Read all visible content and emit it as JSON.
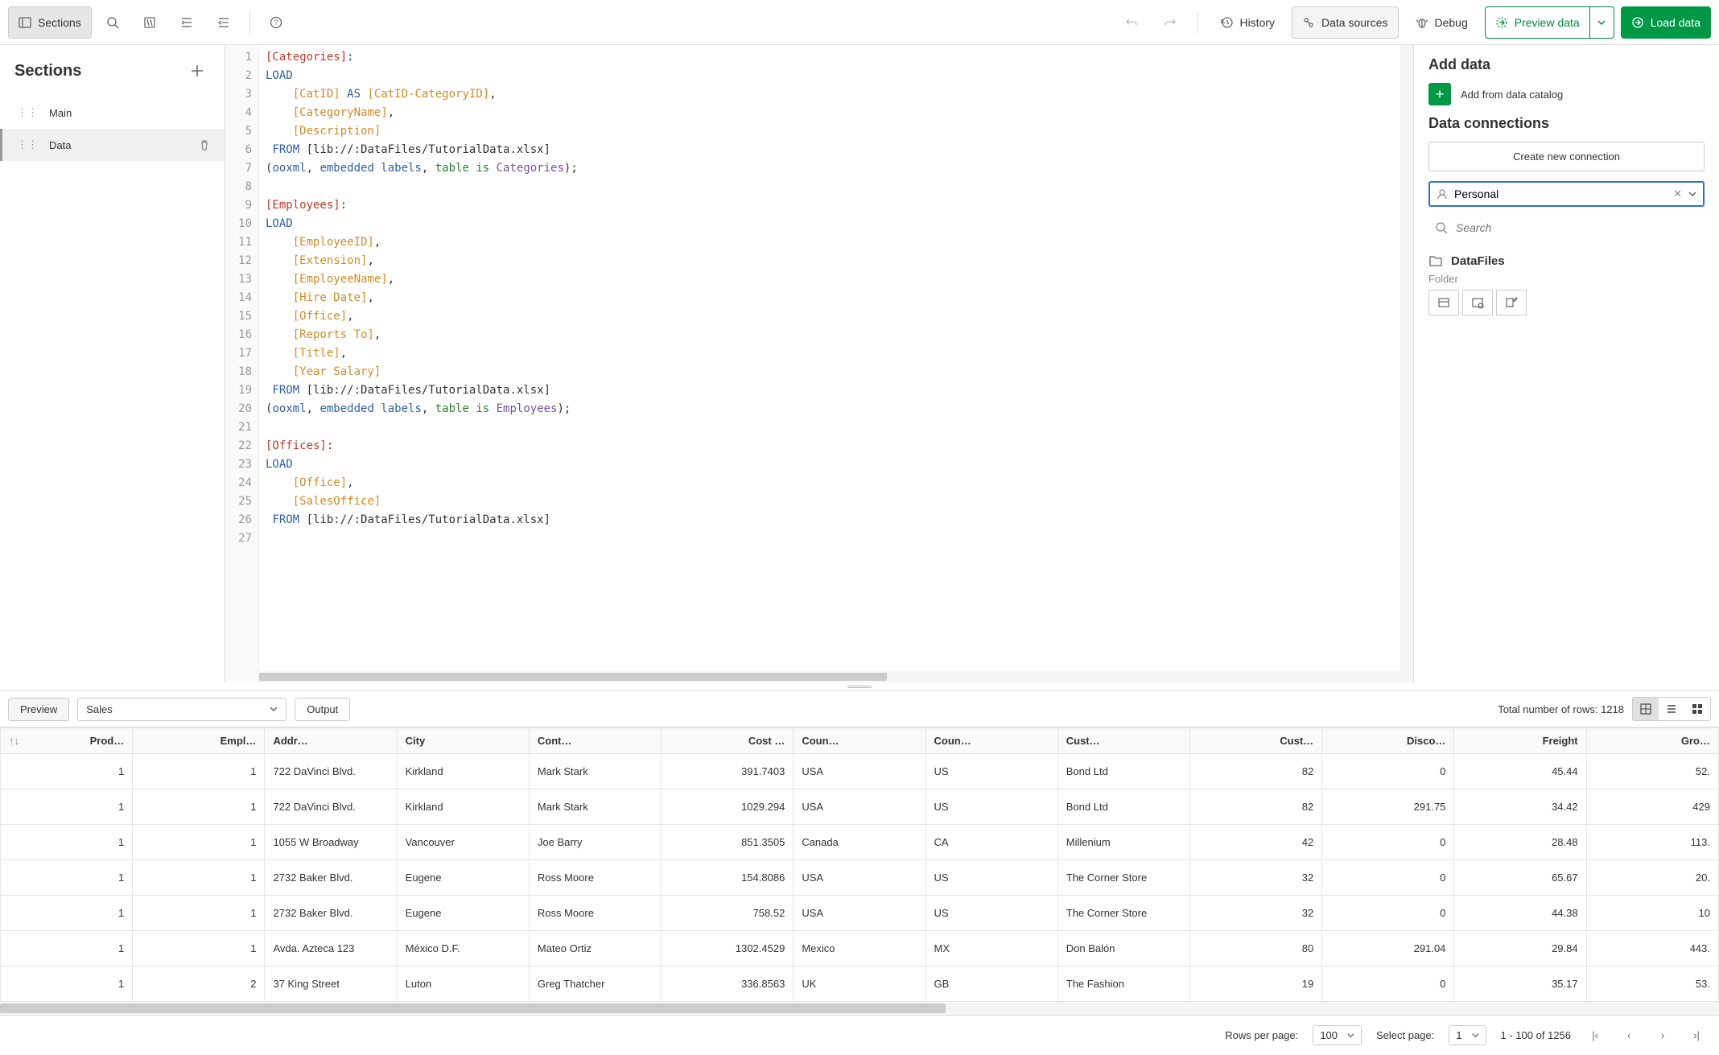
{
  "toolbar": {
    "sections": "Sections",
    "history": "History",
    "data_sources": "Data sources",
    "debug": "Debug",
    "preview_data": "Preview data",
    "load_data": "Load data"
  },
  "sidebar": {
    "title": "Sections",
    "items": [
      {
        "label": "Main",
        "selected": false
      },
      {
        "label": "Data",
        "selected": true
      }
    ]
  },
  "editor": {
    "lines": [
      {
        "n": 1,
        "tokens": [
          {
            "t": "[Categories]",
            "c": "tok-sec"
          },
          {
            "t": ":",
            "c": ""
          }
        ]
      },
      {
        "n": 2,
        "tokens": [
          {
            "t": "LOAD",
            "c": "tok-kw"
          }
        ]
      },
      {
        "n": 3,
        "tokens": [
          {
            "t": "    ",
            "c": ""
          },
          {
            "t": "[CatID]",
            "c": "tok-field"
          },
          {
            "t": " ",
            "c": ""
          },
          {
            "t": "AS",
            "c": "tok-kw"
          },
          {
            "t": " ",
            "c": ""
          },
          {
            "t": "[CatID-CategoryID]",
            "c": "tok-field"
          },
          {
            "t": ",",
            "c": ""
          }
        ]
      },
      {
        "n": 4,
        "tokens": [
          {
            "t": "    ",
            "c": ""
          },
          {
            "t": "[CategoryName]",
            "c": "tok-field"
          },
          {
            "t": ",",
            "c": ""
          }
        ]
      },
      {
        "n": 5,
        "tokens": [
          {
            "t": "    ",
            "c": ""
          },
          {
            "t": "[Description]",
            "c": "tok-field"
          }
        ]
      },
      {
        "n": 6,
        "tokens": [
          {
            "t": " ",
            "c": ""
          },
          {
            "t": "FROM",
            "c": "tok-kw"
          },
          {
            "t": " [lib://:DataFiles/TutorialData.xlsx]",
            "c": ""
          }
        ]
      },
      {
        "n": 7,
        "tokens": [
          {
            "t": "(",
            "c": ""
          },
          {
            "t": "ooxml",
            "c": "tok-func"
          },
          {
            "t": ", ",
            "c": ""
          },
          {
            "t": "embedded labels",
            "c": "tok-func"
          },
          {
            "t": ", ",
            "c": ""
          },
          {
            "t": "table is",
            "c": "tok-green"
          },
          {
            "t": " ",
            "c": ""
          },
          {
            "t": "Categories",
            "c": "tok-param"
          },
          {
            "t": ");",
            "c": ""
          }
        ]
      },
      {
        "n": 8,
        "tokens": []
      },
      {
        "n": 9,
        "tokens": [
          {
            "t": "[Employees]",
            "c": "tok-sec"
          },
          {
            "t": ":",
            "c": ""
          }
        ]
      },
      {
        "n": 10,
        "tokens": [
          {
            "t": "LOAD",
            "c": "tok-kw"
          }
        ]
      },
      {
        "n": 11,
        "tokens": [
          {
            "t": "    ",
            "c": ""
          },
          {
            "t": "[EmployeeID]",
            "c": "tok-field"
          },
          {
            "t": ",",
            "c": ""
          }
        ]
      },
      {
        "n": 12,
        "tokens": [
          {
            "t": "    ",
            "c": ""
          },
          {
            "t": "[Extension]",
            "c": "tok-field"
          },
          {
            "t": ",",
            "c": ""
          }
        ]
      },
      {
        "n": 13,
        "tokens": [
          {
            "t": "    ",
            "c": ""
          },
          {
            "t": "[EmployeeName]",
            "c": "tok-field"
          },
          {
            "t": ",",
            "c": ""
          }
        ]
      },
      {
        "n": 14,
        "tokens": [
          {
            "t": "    ",
            "c": ""
          },
          {
            "t": "[Hire Date]",
            "c": "tok-field"
          },
          {
            "t": ",",
            "c": ""
          }
        ]
      },
      {
        "n": 15,
        "tokens": [
          {
            "t": "    ",
            "c": ""
          },
          {
            "t": "[Office]",
            "c": "tok-field"
          },
          {
            "t": ",",
            "c": ""
          }
        ]
      },
      {
        "n": 16,
        "tokens": [
          {
            "t": "    ",
            "c": ""
          },
          {
            "t": "[Reports To]",
            "c": "tok-field"
          },
          {
            "t": ",",
            "c": ""
          }
        ]
      },
      {
        "n": 17,
        "tokens": [
          {
            "t": "    ",
            "c": ""
          },
          {
            "t": "[Title]",
            "c": "tok-field"
          },
          {
            "t": ",",
            "c": ""
          }
        ]
      },
      {
        "n": 18,
        "tokens": [
          {
            "t": "    ",
            "c": ""
          },
          {
            "t": "[Year Salary]",
            "c": "tok-field"
          }
        ]
      },
      {
        "n": 19,
        "tokens": [
          {
            "t": " ",
            "c": ""
          },
          {
            "t": "FROM",
            "c": "tok-kw"
          },
          {
            "t": " [lib://:DataFiles/TutorialData.xlsx]",
            "c": ""
          }
        ]
      },
      {
        "n": 20,
        "tokens": [
          {
            "t": "(",
            "c": ""
          },
          {
            "t": "ooxml",
            "c": "tok-func"
          },
          {
            "t": ", ",
            "c": ""
          },
          {
            "t": "embedded labels",
            "c": "tok-func"
          },
          {
            "t": ", ",
            "c": ""
          },
          {
            "t": "table is",
            "c": "tok-green"
          },
          {
            "t": " ",
            "c": ""
          },
          {
            "t": "Employees",
            "c": "tok-param"
          },
          {
            "t": ");",
            "c": ""
          }
        ]
      },
      {
        "n": 21,
        "tokens": []
      },
      {
        "n": 22,
        "tokens": [
          {
            "t": "[Offices]",
            "c": "tok-sec"
          },
          {
            "t": ":",
            "c": ""
          }
        ]
      },
      {
        "n": 23,
        "tokens": [
          {
            "t": "LOAD",
            "c": "tok-kw"
          }
        ]
      },
      {
        "n": 24,
        "tokens": [
          {
            "t": "    ",
            "c": ""
          },
          {
            "t": "[Office]",
            "c": "tok-field"
          },
          {
            "t": ",",
            "c": ""
          }
        ]
      },
      {
        "n": 25,
        "tokens": [
          {
            "t": "    ",
            "c": ""
          },
          {
            "t": "[SalesOffice]",
            "c": "tok-field"
          }
        ]
      },
      {
        "n": 26,
        "tokens": [
          {
            "t": " ",
            "c": ""
          },
          {
            "t": "FROM",
            "c": "tok-kw"
          },
          {
            "t": " [lib://:DataFiles/TutorialData.xlsx]",
            "c": ""
          }
        ]
      },
      {
        "n": 27,
        "tokens": []
      }
    ]
  },
  "rpanel": {
    "add_data": "Add data",
    "catalog": "Add from data catalog",
    "connections": "Data connections",
    "create_new": "Create new connection",
    "filter_value": "Personal",
    "search_placeholder": "Search",
    "conn": {
      "name": "DataFiles",
      "type": "Folder"
    }
  },
  "preview": {
    "preview_tab": "Preview",
    "output_tab": "Output",
    "table_selected": "Sales",
    "total_rows_label": "Total number of rows: 1218",
    "columns": [
      {
        "key": "prod",
        "label": "Prod…",
        "num": true
      },
      {
        "key": "empl",
        "label": "Empl…",
        "num": true
      },
      {
        "key": "addr",
        "label": "Addr…",
        "num": false
      },
      {
        "key": "city",
        "label": "City",
        "num": false
      },
      {
        "key": "cont",
        "label": "Cont…",
        "num": false
      },
      {
        "key": "cost",
        "label": "Cost …",
        "num": true
      },
      {
        "key": "coun",
        "label": "Coun…",
        "num": false
      },
      {
        "key": "counc",
        "label": "Coun…",
        "num": false
      },
      {
        "key": "cust",
        "label": "Cust…",
        "num": false
      },
      {
        "key": "custn",
        "label": "Cust…",
        "num": true
      },
      {
        "key": "disc",
        "label": "Disco…",
        "num": true
      },
      {
        "key": "freight",
        "label": "Freight",
        "num": true
      },
      {
        "key": "gro",
        "label": "Gro…",
        "num": true
      }
    ],
    "rows": [
      {
        "prod": "1",
        "empl": "1",
        "addr": "722 DaVinci Blvd.",
        "city": "Kirkland",
        "cont": "Mark Stark",
        "cost": "391.7403",
        "coun": "USA",
        "counc": "US",
        "cust": "Bond Ltd",
        "custn": "82",
        "disc": "0",
        "freight": "45.44",
        "gro": "52."
      },
      {
        "prod": "1",
        "empl": "1",
        "addr": "722 DaVinci Blvd.",
        "city": "Kirkland",
        "cont": "Mark Stark",
        "cost": "1029.294",
        "coun": "USA",
        "counc": "US",
        "cust": "Bond Ltd",
        "custn": "82",
        "disc": "291.75",
        "freight": "34.42",
        "gro": "429"
      },
      {
        "prod": "1",
        "empl": "1",
        "addr": "1055 W Broadway",
        "city": "Vancouver",
        "cont": "Joe Barry",
        "cost": "851.3505",
        "coun": "Canada",
        "counc": "CA",
        "cust": "Millenium",
        "custn": "42",
        "disc": "0",
        "freight": "28.48",
        "gro": "113."
      },
      {
        "prod": "1",
        "empl": "1",
        "addr": "2732 Baker Blvd.",
        "city": "Eugene",
        "cont": "Ross Moore",
        "cost": "154.8086",
        "coun": "USA",
        "counc": "US",
        "cust": "The Corner Store",
        "custn": "32",
        "disc": "0",
        "freight": "65.67",
        "gro": "20."
      },
      {
        "prod": "1",
        "empl": "1",
        "addr": "2732 Baker Blvd.",
        "city": "Eugene",
        "cont": "Ross Moore",
        "cost": "758.52",
        "coun": "USA",
        "counc": "US",
        "cust": "The Corner Store",
        "custn": "32",
        "disc": "0",
        "freight": "44.38",
        "gro": "10"
      },
      {
        "prod": "1",
        "empl": "1",
        "addr": "Avda. Azteca 123",
        "city": "México D.F.",
        "cont": "Mateo Ortiz",
        "cost": "1302.4529",
        "coun": "Mexico",
        "counc": "MX",
        "cust": "Don Balón",
        "custn": "80",
        "disc": "291.04",
        "freight": "29.84",
        "gro": "443."
      },
      {
        "prod": "1",
        "empl": "2",
        "addr": "37 King Street",
        "city": "Luton",
        "cont": "Greg Thatcher",
        "cost": "336.8563",
        "coun": "UK",
        "counc": "GB",
        "cust": "The Fashion",
        "custn": "19",
        "disc": "0",
        "freight": "35.17",
        "gro": "53."
      }
    ]
  },
  "pager": {
    "rows_label": "Rows per page:",
    "rows_value": "100",
    "page_label": "Select page:",
    "page_value": "1",
    "range": "1 - 100 of 1256"
  }
}
